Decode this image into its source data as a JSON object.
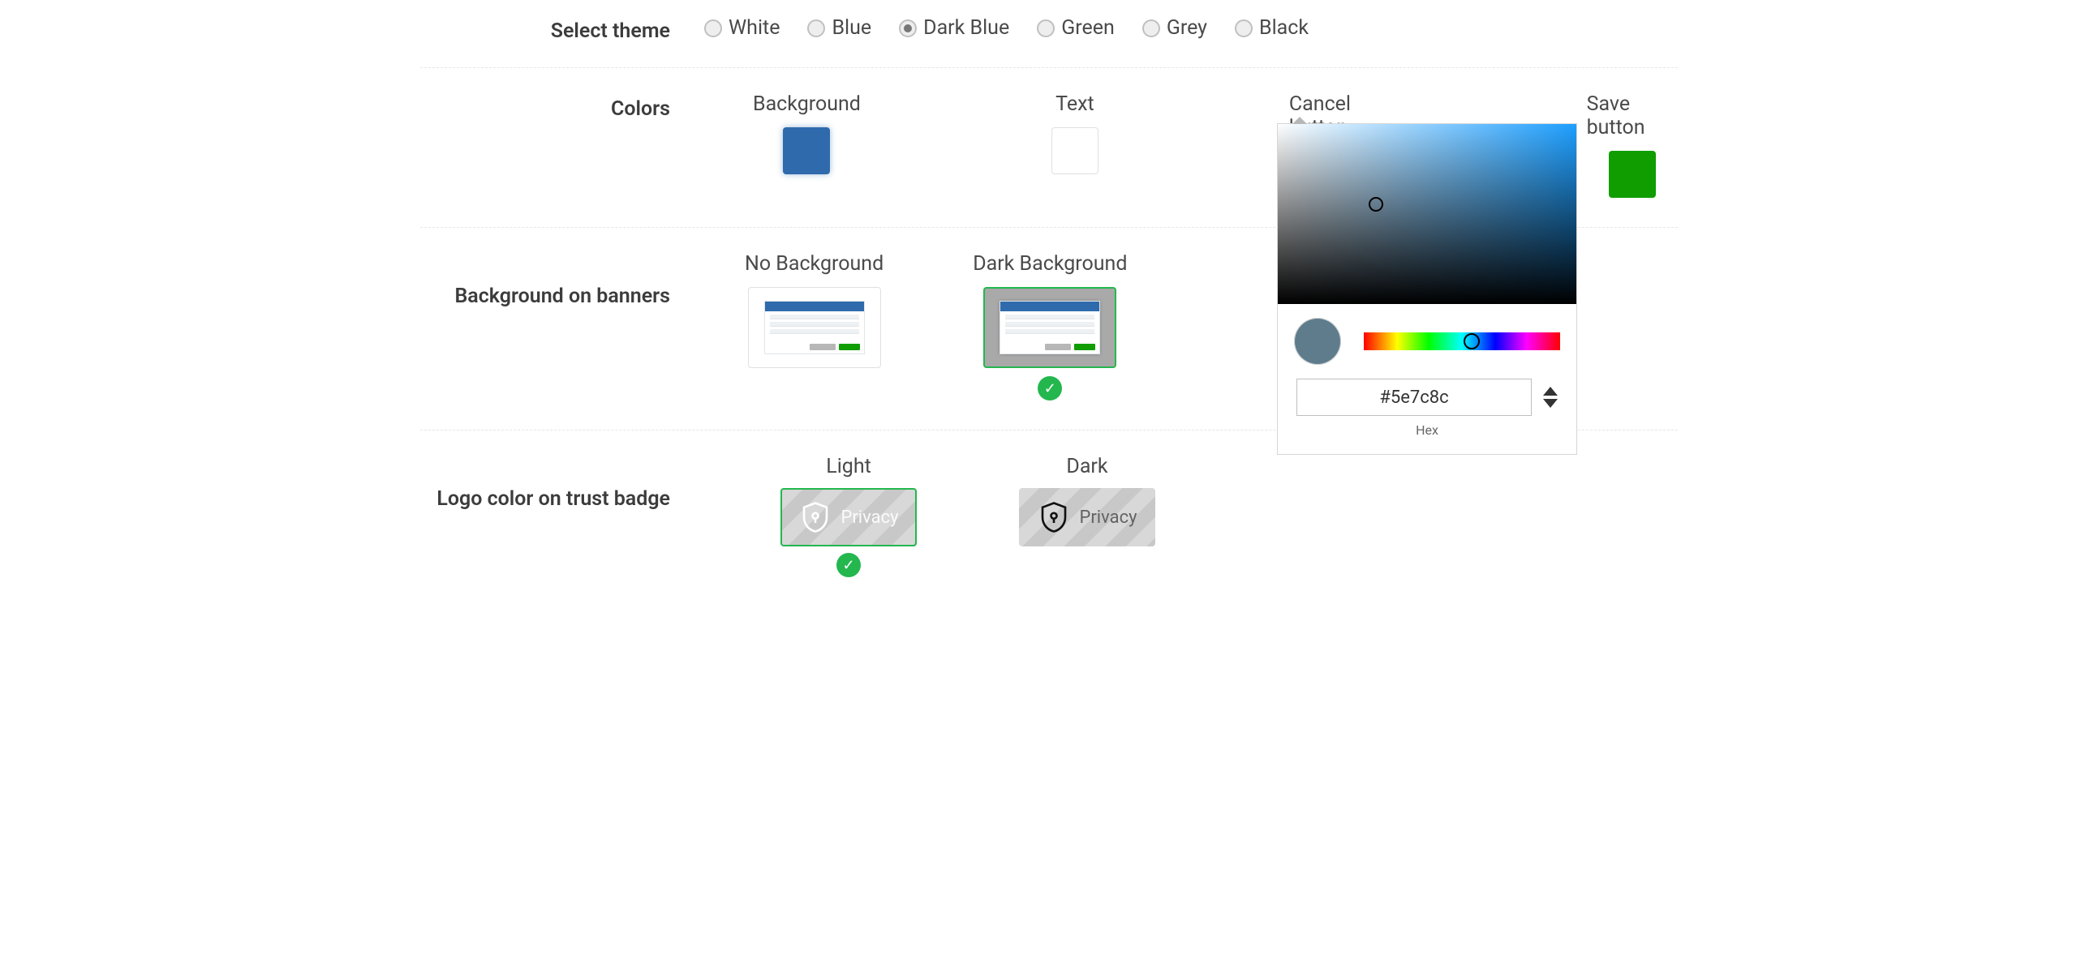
{
  "theme": {
    "label": "Select theme",
    "options": [
      "White",
      "Blue",
      "Dark Blue",
      "Green",
      "Grey",
      "Black"
    ],
    "selected": "Dark Blue"
  },
  "colors": {
    "label": "Colors",
    "items": {
      "background": {
        "label": "Background",
        "value": "#2f6aad"
      },
      "text": {
        "label": "Text",
        "value": "#ffffff"
      },
      "cancel": {
        "label": "Cancel button",
        "value": "#5e7c8c"
      },
      "save": {
        "label": "Save button",
        "value": "#0f9d00"
      }
    }
  },
  "banners": {
    "label": "Background on banners",
    "options": {
      "none": {
        "label": "No Background",
        "selected": false
      },
      "dark": {
        "label": "Dark Background",
        "selected": true
      }
    }
  },
  "trust_badge": {
    "label": "Logo color on trust badge",
    "text": "Privacy",
    "options": {
      "light": {
        "label": "Light",
        "selected": true
      },
      "dark": {
        "label": "Dark",
        "selected": false
      }
    }
  },
  "picker": {
    "hex": "#5e7c8c",
    "label": "Hex"
  }
}
